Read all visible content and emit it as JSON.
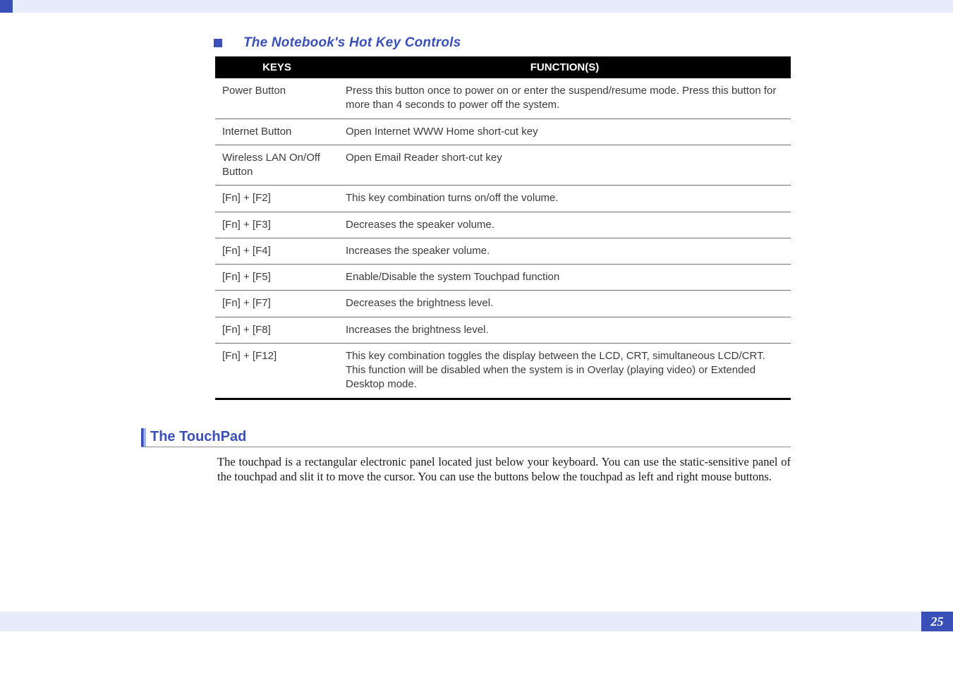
{
  "section_title": "The Notebook's Hot Key Controls",
  "table": {
    "headers": {
      "keys": "KEYS",
      "func": "FUNCTION(S)"
    },
    "rows": [
      {
        "key": "Power Button",
        "func": "Press this button once to power on or enter the suspend/resume mode.  Press this button for more than 4 seconds to power off the system."
      },
      {
        "key": "Internet Button",
        "func": "Open Internet WWW Home short-cut key"
      },
      {
        "key": "Wireless LAN On/Off  Button",
        "func": "Open Email Reader short-cut key"
      },
      {
        "key": "[Fn] + [F2]",
        "func": "This key combination turns on/off the volume."
      },
      {
        "key": "[Fn] + [F3]",
        "func": "Decreases the speaker volume."
      },
      {
        "key": "[Fn] + [F4]",
        "func": "Increases the speaker volume."
      },
      {
        "key": "[Fn] + [F5]",
        "func": "Enable/Disable the system Touchpad function"
      },
      {
        "key": "[Fn] + [F7]",
        "func": "Decreases the brightness level."
      },
      {
        "key": "[Fn] + [F8]",
        "func": "Increases the brightness level."
      },
      {
        "key": "[Fn] + [F12]",
        "func": "This key combination toggles the display between the LCD, CRT, simultaneous LCD/CRT.  This function will be disabled when the system is in Overlay (playing video) or Extended Desktop mode."
      }
    ]
  },
  "touchpad": {
    "title": "The TouchPad",
    "body": "The touchpad is a rectangular electronic panel located just below your keyboard. You can use the static-sensitive panel of the touchpad and slit it to move the cursor.  You can use the buttons below the touchpad as left and right mouse buttons."
  },
  "page_number": "25"
}
